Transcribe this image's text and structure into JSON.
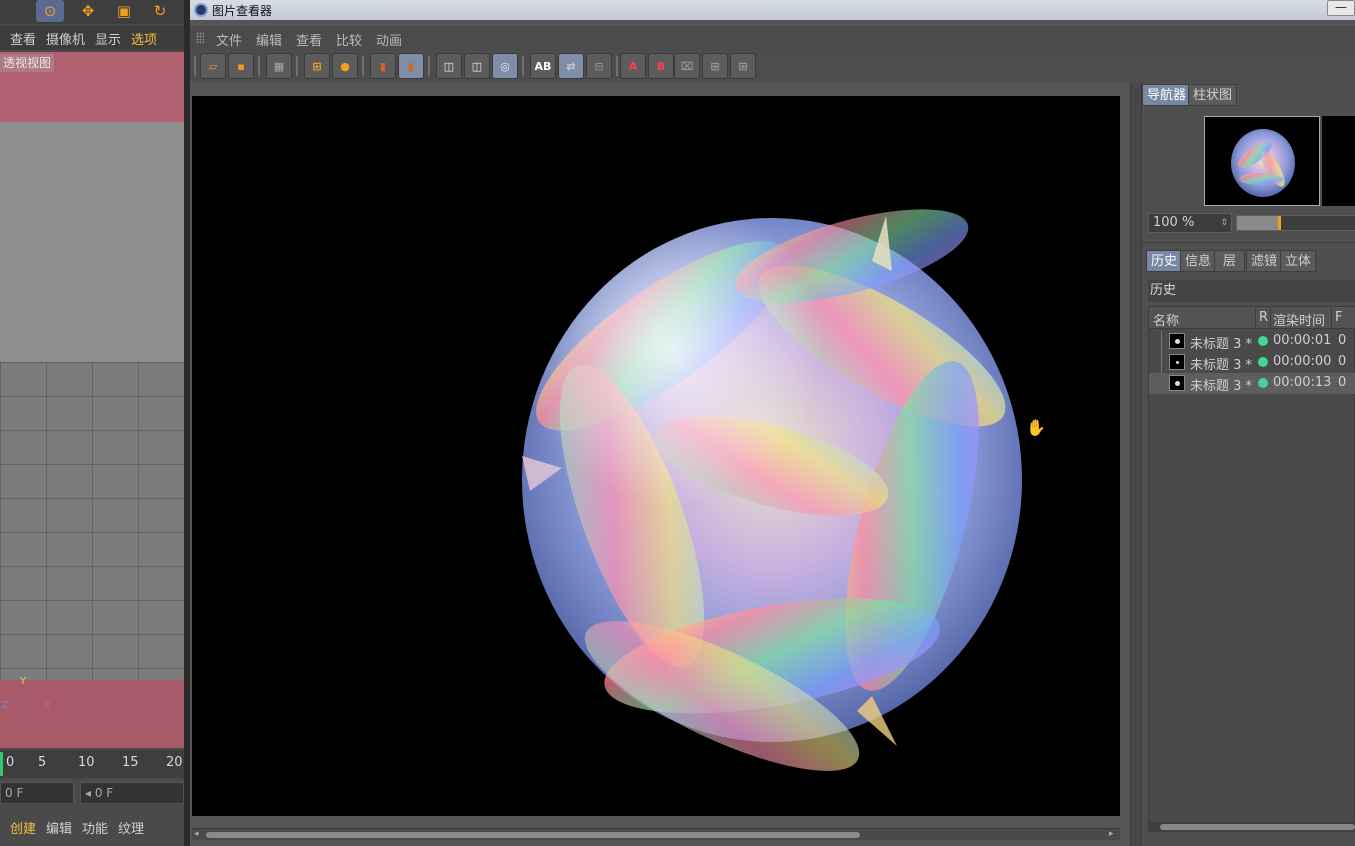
{
  "background_app": {
    "menu": [
      "查看",
      "摄像机",
      "显示",
      "选项"
    ],
    "active_menu": "选项",
    "viewport_label": "透视视图",
    "axis_labels": {
      "y": "Y",
      "z": "Z",
      "x": "X"
    },
    "timeline_ticks": [
      "0",
      "5",
      "10",
      "15",
      "20"
    ],
    "frame_field_left": "0 F",
    "frame_field_right": "0 F",
    "bottom_menu": [
      "创建",
      "编辑",
      "功能",
      "纹理"
    ],
    "active_bottom_menu": "创建"
  },
  "viewer": {
    "title": "图片查看器",
    "menu": [
      "文件",
      "编辑",
      "查看",
      "比较",
      "动画"
    ],
    "minimize_glyph": "—",
    "toolbar_text_buttons": {
      "ab_compare": "AB",
      "a_marker": "A",
      "b_marker": "B"
    },
    "accent_color": "#f0a020",
    "active_tab_color": "#7788a4"
  },
  "right_panel": {
    "top_tabs": [
      "导航器",
      "柱状图"
    ],
    "active_top_tab": "导航器",
    "zoom_value": "100 %",
    "zoom_level": 0.33,
    "bottom_tabs": [
      "历史",
      "信息",
      "层",
      "滤镜",
      "立体"
    ],
    "active_bottom_tab": "历史",
    "history_title": "历史",
    "history_columns": {
      "name": "名称",
      "r": "R",
      "render_time": "渲染时间",
      "f": "F"
    },
    "history_rows": [
      {
        "name": "未标题 3 *",
        "time": "00:00:01",
        "f": "0",
        "selected": false
      },
      {
        "name": "未标题 3 *",
        "time": "00:00:00",
        "f": "0",
        "selected": false
      },
      {
        "name": "未标题 3 *",
        "time": "00:00:13",
        "f": "0",
        "selected": true
      }
    ],
    "status_color": "#40d890"
  }
}
